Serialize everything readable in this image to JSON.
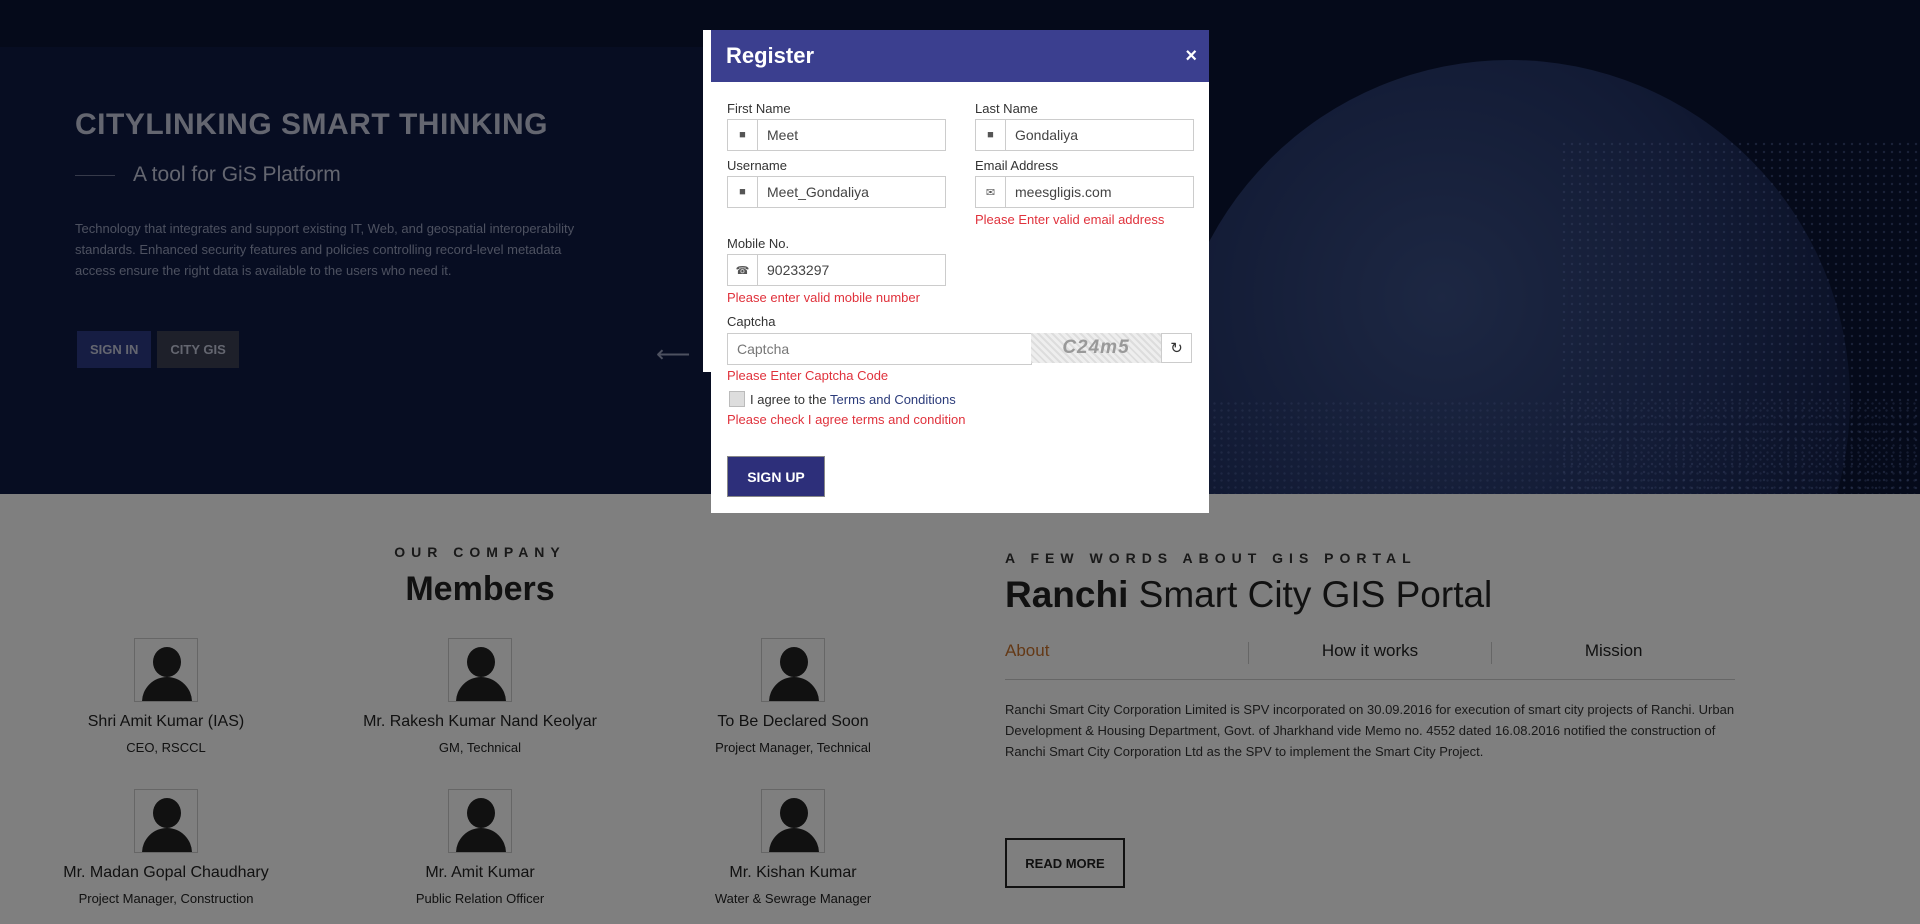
{
  "hero": {
    "title": "CITYLINKING SMART THINKING",
    "subtitle": "A tool for GiS Platform",
    "description": "Technology that integrates and support existing IT, Web, and geospatial interoperability standards. Enhanced security features and policies controlling record-level metadata access ensure the right data is available to the users who need it.",
    "sign_in": "SIGN IN",
    "city_gis": "CITY GIS",
    "arrow_icon": "arrow-left-icon"
  },
  "company": {
    "label": "OUR COMPANY",
    "title": "Members",
    "members": [
      {
        "name": "Shri Amit Kumar (IAS)",
        "role": "CEO, RSCCL"
      },
      {
        "name": "Mr. Rakesh Kumar Nand Keolyar",
        "role": "GM, Technical"
      },
      {
        "name": "To Be Declared Soon",
        "role": "Project Manager, Technical"
      },
      {
        "name": "Mr. Madan Gopal Chaudhary",
        "role": "Project Manager, Construction"
      },
      {
        "name": "Mr. Amit Kumar",
        "role": "Public Relation Officer"
      },
      {
        "name": "Mr. Kishan Kumar",
        "role": "Water & Sewrage Manager"
      }
    ]
  },
  "portal": {
    "label": "A FEW WORDS ABOUT GIS PORTAL",
    "title_bold": "Ranchi",
    "title_rest": "Smart City GIS Portal",
    "tabs": [
      "About",
      "How it works",
      "Mission"
    ],
    "active_tab": "About",
    "about_text": "Ranchi Smart City Corporation Limited is SPV incorporated on 30.09.2016 for execution of smart city projects of Ranchi. Urban Development & Housing Department, Govt. of Jharkhand vide Memo no. 4552 dated 16.08.2016 notified the construction of Ranchi Smart City Corporation Ltd as the SPV to implement the Smart City Project.",
    "read_more": "READ MORE"
  },
  "modal": {
    "title": "Register",
    "close_icon": "×",
    "first_name": {
      "label": "First Name",
      "value": "Meet"
    },
    "last_name": {
      "label": "Last Name",
      "value": "Gondaliya"
    },
    "username": {
      "label": "Username",
      "value": "Meet_Gondaliya"
    },
    "email": {
      "label": "Email Address",
      "value": "meesgligis.com",
      "error": "Please Enter valid email address"
    },
    "mobile": {
      "label": "Mobile No.",
      "value": "90233297",
      "error": "Please enter valid mobile number"
    },
    "captcha": {
      "label": "Captcha",
      "placeholder": "Captcha",
      "image_text": "C24m5",
      "error": "Please Enter Captcha Code"
    },
    "terms": {
      "prefix": "I agree to the",
      "link": "Terms and Conditions",
      "error": "Please check I agree terms and condition"
    },
    "signup": "SIGN UP"
  },
  "colors": {
    "modal_header": "#3b3f8f",
    "error": "#e0323c",
    "active_tab": "#c9722c"
  }
}
